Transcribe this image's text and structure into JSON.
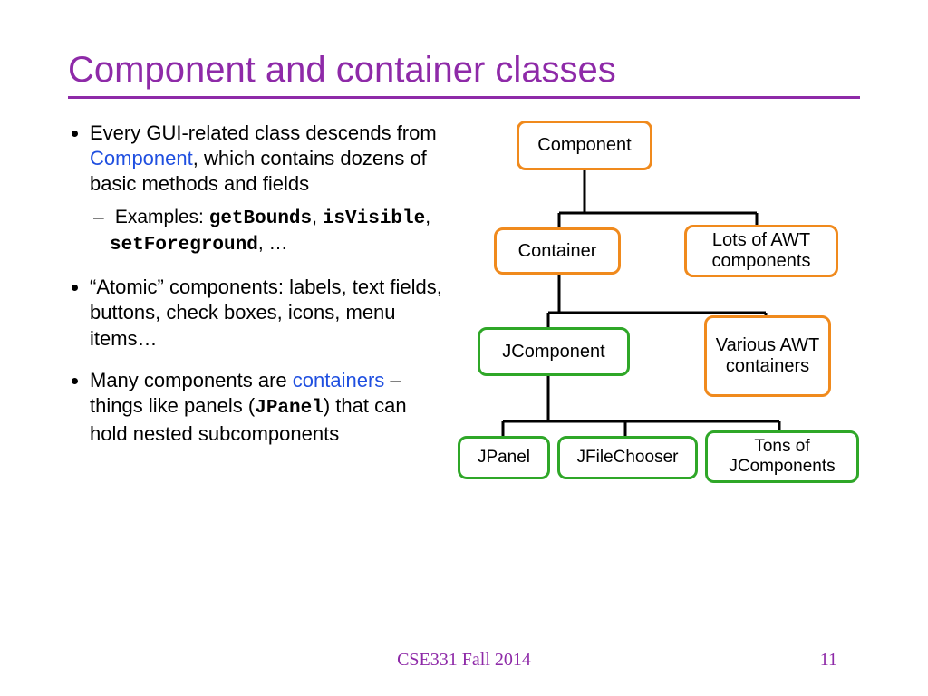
{
  "title": "Component and container classes",
  "bullets": {
    "b1_pre": "Every GUI-related class descends from ",
    "b1_comp": "Component",
    "b1_post": ", which contains dozens of basic methods and fields",
    "b1_sub_pre": "Examples: ",
    "b1_code1": "getBounds",
    "b1_code2": "isVisible",
    "b1_code3": "setForeground",
    "b1_sub_post": ", …",
    "b2": "“Atomic” components: labels, text fields, buttons, check boxes, icons, menu items…",
    "b3_pre": "Many components are ",
    "b3_cont": "containers",
    "b3_mid": " – things like panels (",
    "b3_code": "JPanel",
    "b3_post": ") that can hold nested subcomponents"
  },
  "nodes": {
    "component": "Component",
    "container": "Container",
    "awt_comp": "Lots of AWT components",
    "jcomponent": "JComponent",
    "awt_cont": "Various AWT containers",
    "jpanel": "JPanel",
    "jfilechooser": "JFileChooser",
    "tons": "Tons of JComponents"
  },
  "footer": "CSE331 Fall 2014",
  "page": "11"
}
